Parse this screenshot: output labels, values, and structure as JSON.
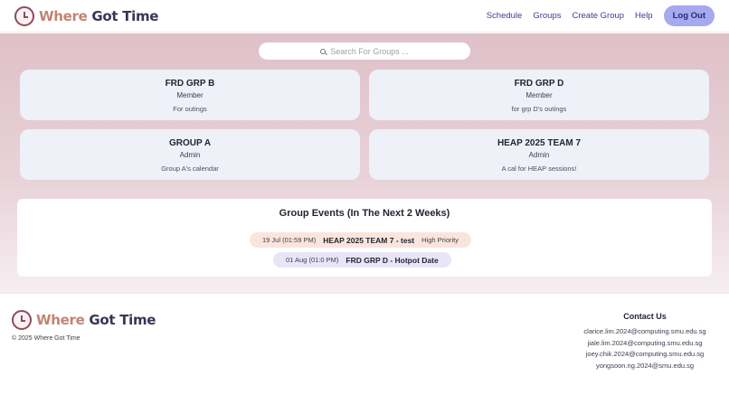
{
  "header": {
    "brand_part1": "Where ",
    "brand_part2": "Got Time",
    "nav": [
      "Schedule",
      "Groups",
      "Create Group",
      "Help"
    ],
    "logout_label": "Log Out"
  },
  "search": {
    "placeholder": "Search For Groups ..."
  },
  "groups": [
    {
      "name": "FRD GRP B",
      "role": "Member",
      "description": "For outings"
    },
    {
      "name": "FRD GRP D",
      "role": "Member",
      "description": "for grp D's outings"
    },
    {
      "name": "GROUP A",
      "role": "Admin",
      "description": "Group A's calendar"
    },
    {
      "name": "HEAP 2025 TEAM 7",
      "role": "Admin",
      "description": "A cal for HEAP sessions!"
    }
  ],
  "events": {
    "heading": "Group Events (In The Next 2 Weeks)",
    "items": [
      {
        "datetime": "19 Jul (01:59 PM)",
        "title": "HEAP 2025 TEAM 7 - test",
        "priority": "High Priority"
      },
      {
        "datetime": "01 Aug (01:0 PM)",
        "title": "FRD GRP D - Hotpot Date",
        "priority": ""
      }
    ]
  },
  "footer": {
    "brand_part1": "Where ",
    "brand_part2": "Got Time",
    "copyright": "© 2025 Where Got Time",
    "contact_heading": "Contact Us",
    "emails": [
      "clarice.lim.2024@computing.smu.edu.sg",
      "jiale.lim.2024@computing.smu.edu.sg",
      "joey.chik.2024@computing.smu.edu.sg",
      "yongsoon.ng.2024@smu.edu.sg"
    ]
  },
  "colors": {
    "accent": "#a6a8f0",
    "brand_warm": "#c08473",
    "brand_dark": "#3b3553",
    "card_bg": "#eef1f7"
  },
  "icons": {
    "logo": "clock-icon",
    "search": "search-icon"
  }
}
